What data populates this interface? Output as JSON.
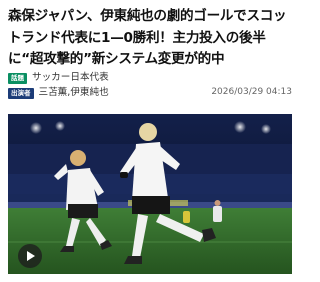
{
  "article": {
    "headline": "森保ジャパン、伊東純也の劇的ゴールでスコットランド代表に1—0勝利！主力投入の後半に“超攻撃的”新システム変更が的中",
    "category_badge": "話題",
    "category": "サッカー日本代表",
    "source_badge": "出演者",
    "source": "三苫薫,伊東純也",
    "timestamp": "2026/03/29 04:13"
  },
  "media": {
    "type": "video",
    "play_icon": "play-icon"
  },
  "colors": {
    "category_badge": "#0a8f62",
    "source_badge": "#1c3c78",
    "stadium_sky": "#0d1733",
    "pitch": "#2f6b2a"
  }
}
